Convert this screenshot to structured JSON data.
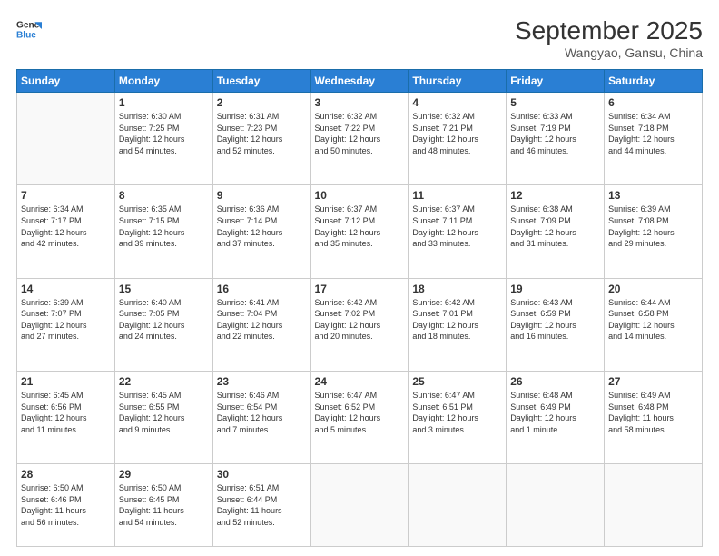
{
  "logo": {
    "line1": "General",
    "line2": "Blue"
  },
  "header": {
    "title": "September 2025",
    "subtitle": "Wangyao, Gansu, China"
  },
  "days": [
    "Sunday",
    "Monday",
    "Tuesday",
    "Wednesday",
    "Thursday",
    "Friday",
    "Saturday"
  ],
  "weeks": [
    [
      {
        "day": "",
        "content": ""
      },
      {
        "day": "1",
        "content": "Sunrise: 6:30 AM\nSunset: 7:25 PM\nDaylight: 12 hours\nand 54 minutes."
      },
      {
        "day": "2",
        "content": "Sunrise: 6:31 AM\nSunset: 7:23 PM\nDaylight: 12 hours\nand 52 minutes."
      },
      {
        "day": "3",
        "content": "Sunrise: 6:32 AM\nSunset: 7:22 PM\nDaylight: 12 hours\nand 50 minutes."
      },
      {
        "day": "4",
        "content": "Sunrise: 6:32 AM\nSunset: 7:21 PM\nDaylight: 12 hours\nand 48 minutes."
      },
      {
        "day": "5",
        "content": "Sunrise: 6:33 AM\nSunset: 7:19 PM\nDaylight: 12 hours\nand 46 minutes."
      },
      {
        "day": "6",
        "content": "Sunrise: 6:34 AM\nSunset: 7:18 PM\nDaylight: 12 hours\nand 44 minutes."
      }
    ],
    [
      {
        "day": "7",
        "content": "Sunrise: 6:34 AM\nSunset: 7:17 PM\nDaylight: 12 hours\nand 42 minutes."
      },
      {
        "day": "8",
        "content": "Sunrise: 6:35 AM\nSunset: 7:15 PM\nDaylight: 12 hours\nand 39 minutes."
      },
      {
        "day": "9",
        "content": "Sunrise: 6:36 AM\nSunset: 7:14 PM\nDaylight: 12 hours\nand 37 minutes."
      },
      {
        "day": "10",
        "content": "Sunrise: 6:37 AM\nSunset: 7:12 PM\nDaylight: 12 hours\nand 35 minutes."
      },
      {
        "day": "11",
        "content": "Sunrise: 6:37 AM\nSunset: 7:11 PM\nDaylight: 12 hours\nand 33 minutes."
      },
      {
        "day": "12",
        "content": "Sunrise: 6:38 AM\nSunset: 7:09 PM\nDaylight: 12 hours\nand 31 minutes."
      },
      {
        "day": "13",
        "content": "Sunrise: 6:39 AM\nSunset: 7:08 PM\nDaylight: 12 hours\nand 29 minutes."
      }
    ],
    [
      {
        "day": "14",
        "content": "Sunrise: 6:39 AM\nSunset: 7:07 PM\nDaylight: 12 hours\nand 27 minutes."
      },
      {
        "day": "15",
        "content": "Sunrise: 6:40 AM\nSunset: 7:05 PM\nDaylight: 12 hours\nand 24 minutes."
      },
      {
        "day": "16",
        "content": "Sunrise: 6:41 AM\nSunset: 7:04 PM\nDaylight: 12 hours\nand 22 minutes."
      },
      {
        "day": "17",
        "content": "Sunrise: 6:42 AM\nSunset: 7:02 PM\nDaylight: 12 hours\nand 20 minutes."
      },
      {
        "day": "18",
        "content": "Sunrise: 6:42 AM\nSunset: 7:01 PM\nDaylight: 12 hours\nand 18 minutes."
      },
      {
        "day": "19",
        "content": "Sunrise: 6:43 AM\nSunset: 6:59 PM\nDaylight: 12 hours\nand 16 minutes."
      },
      {
        "day": "20",
        "content": "Sunrise: 6:44 AM\nSunset: 6:58 PM\nDaylight: 12 hours\nand 14 minutes."
      }
    ],
    [
      {
        "day": "21",
        "content": "Sunrise: 6:45 AM\nSunset: 6:56 PM\nDaylight: 12 hours\nand 11 minutes."
      },
      {
        "day": "22",
        "content": "Sunrise: 6:45 AM\nSunset: 6:55 PM\nDaylight: 12 hours\nand 9 minutes."
      },
      {
        "day": "23",
        "content": "Sunrise: 6:46 AM\nSunset: 6:54 PM\nDaylight: 12 hours\nand 7 minutes."
      },
      {
        "day": "24",
        "content": "Sunrise: 6:47 AM\nSunset: 6:52 PM\nDaylight: 12 hours\nand 5 minutes."
      },
      {
        "day": "25",
        "content": "Sunrise: 6:47 AM\nSunset: 6:51 PM\nDaylight: 12 hours\nand 3 minutes."
      },
      {
        "day": "26",
        "content": "Sunrise: 6:48 AM\nSunset: 6:49 PM\nDaylight: 12 hours\nand 1 minute."
      },
      {
        "day": "27",
        "content": "Sunrise: 6:49 AM\nSunset: 6:48 PM\nDaylight: 11 hours\nand 58 minutes."
      }
    ],
    [
      {
        "day": "28",
        "content": "Sunrise: 6:50 AM\nSunset: 6:46 PM\nDaylight: 11 hours\nand 56 minutes."
      },
      {
        "day": "29",
        "content": "Sunrise: 6:50 AM\nSunset: 6:45 PM\nDaylight: 11 hours\nand 54 minutes."
      },
      {
        "day": "30",
        "content": "Sunrise: 6:51 AM\nSunset: 6:44 PM\nDaylight: 11 hours\nand 52 minutes."
      },
      {
        "day": "",
        "content": ""
      },
      {
        "day": "",
        "content": ""
      },
      {
        "day": "",
        "content": ""
      },
      {
        "day": "",
        "content": ""
      }
    ]
  ]
}
